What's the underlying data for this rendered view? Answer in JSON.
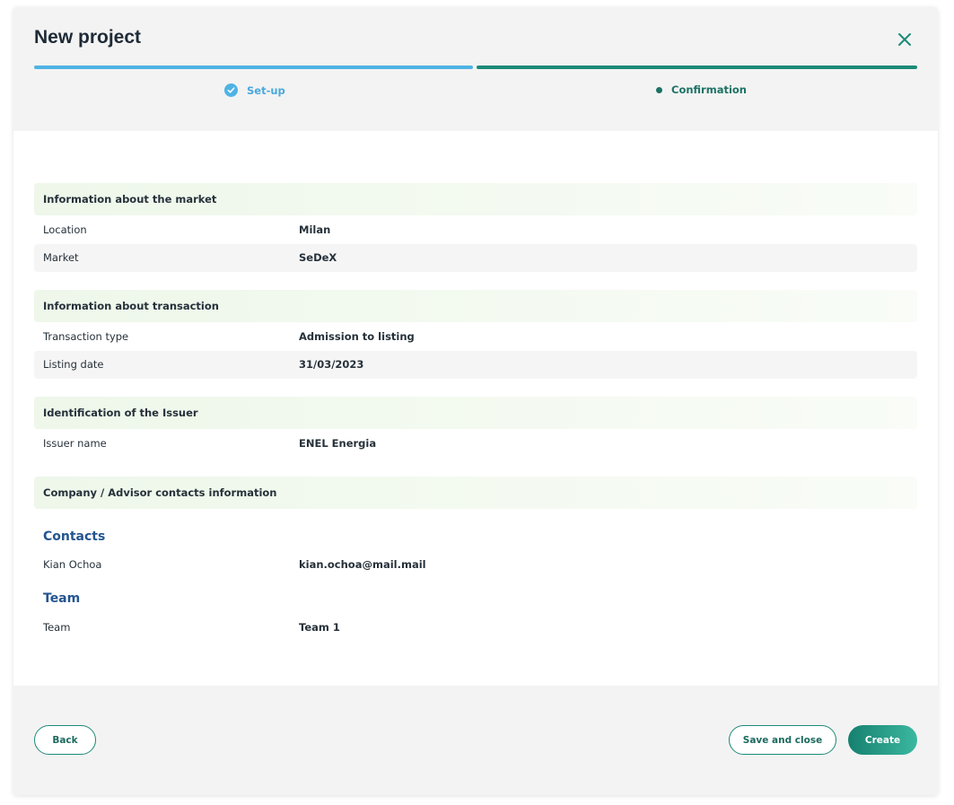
{
  "dialog": {
    "title": "New project",
    "close_icon": "close-icon"
  },
  "steps": [
    {
      "label": "Set-up",
      "state": "completed",
      "icon": "check-circle-icon",
      "color": "#4fb3e4"
    },
    {
      "label": "Confirmation",
      "state": "current",
      "icon": "dot-icon",
      "color": "#1c7264"
    }
  ],
  "sections": {
    "market": {
      "title": "Information about the market",
      "rows": [
        {
          "label": "Location",
          "value": "Milan"
        },
        {
          "label": "Market",
          "value": "SeDeX"
        }
      ]
    },
    "transaction": {
      "title": "Information about transaction",
      "rows": [
        {
          "label": "Transaction type",
          "value": "Admission to listing"
        },
        {
          "label": "Listing date",
          "value": "31/03/2023"
        }
      ]
    },
    "issuer": {
      "title": "Identification of the Issuer",
      "rows": [
        {
          "label": "Issuer name",
          "value": "ENEL Energia"
        }
      ]
    },
    "contacts": {
      "title": "Company / Advisor contacts information",
      "contacts_heading": "Contacts",
      "contacts_rows": [
        {
          "label": "Kian Ochoa",
          "value": "kian.ochoa@mail.mail"
        }
      ],
      "team_heading": "Team",
      "team_rows": [
        {
          "label": "Team",
          "value": "Team 1"
        }
      ]
    }
  },
  "footer": {
    "back_label": "Back",
    "save_label": "Save and close",
    "create_label": "Create"
  },
  "colors": {
    "accent_teal": "#1c8a78",
    "accent_blue": "#4fb3e4",
    "heading_blue": "#24558f"
  }
}
